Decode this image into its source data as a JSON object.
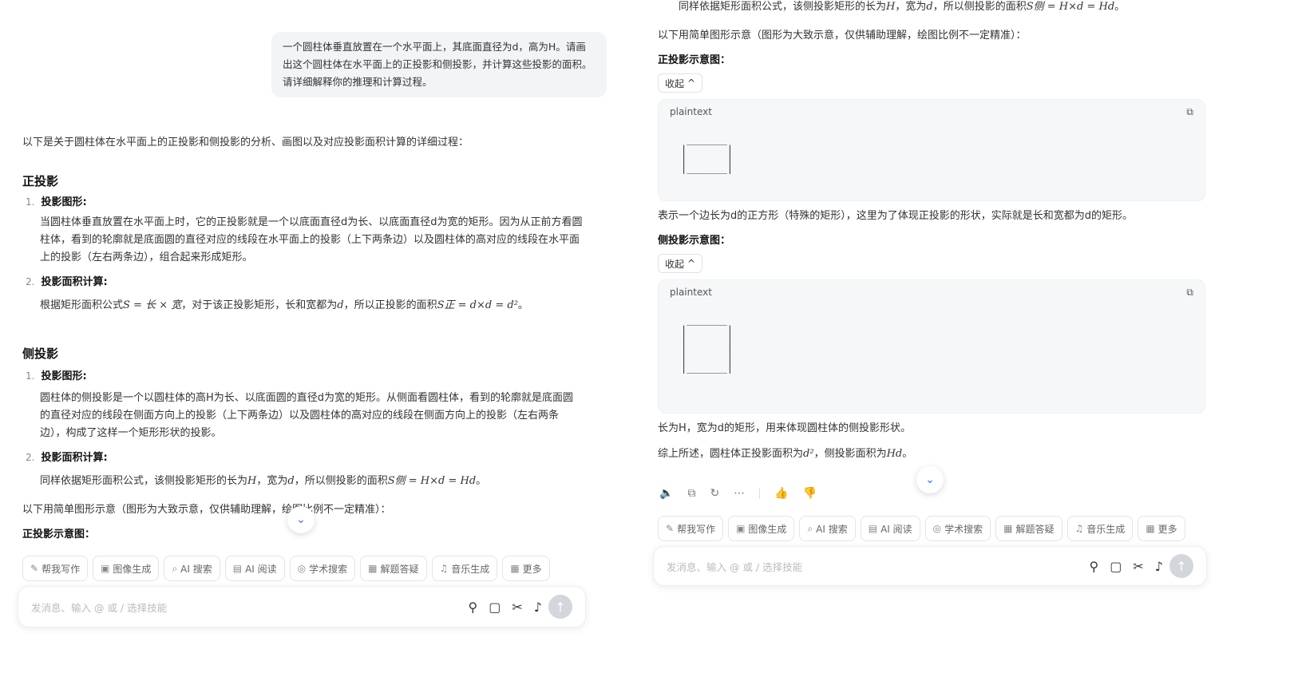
{
  "left": {
    "user_message": "一个圆柱体垂直放置在一个水平面上，其底面直径为d，高为H。请画出这个圆柱体在水平面上的正投影和侧投影，并计算这些投影的面积。请详细解释你的推理和计算过程。",
    "intro": "以下是关于圆柱体在水平面上的正投影和侧投影的分析、画图以及对应投影面积计算的详细过程：",
    "section1_title": "正投影",
    "s1_item1_num": "1.",
    "s1_item1_title": "投影图形",
    "s1_item1_body": "当圆柱体垂直放置在水平面上时，它的正投影就是一个以底面直径d为长、以底面直径d为宽的矩形。因为从正前方看圆柱体，看到的轮廓就是底面圆的直径对应的线段在水平面上的投影（上下两条边）以及圆柱体的高对应的线段在水平面上的投影（左右两条边），组合起来形成矩形。",
    "s1_item2_num": "2.",
    "s1_item2_title": "投影面积计算",
    "s1_item2_pre": "根据矩形面积公式",
    "s1_item2_formula1": "S = 长 × 宽",
    "s1_item2_mid": "，对于该正投影矩形，长和宽都为",
    "s1_item2_d": "d",
    "s1_item2_mid2": "，所以正投影的面积",
    "s1_item2_formula2": "S正 = d×d = d²",
    "s1_item2_end": "。",
    "section2_title": "侧投影",
    "s2_item1_num": "1.",
    "s2_item1_title": "投影图形",
    "s2_item1_body": "圆柱体的侧投影是一个以圆柱体的高H为长、以底面圆的直径d为宽的矩形。从侧面看圆柱体，看到的轮廓就是底面圆的直径对应的线段在侧面方向上的投影（上下两条边）以及圆柱体的高对应的线段在侧面方向上的投影（左右两条边），构成了这样一个矩形形状的投影。",
    "s2_item2_num": "2.",
    "s2_item2_title": "投影面积计算",
    "s2_item2_pre": "同样依据矩形面积公式，该侧投影矩形的长为",
    "s2_item2_H": "H",
    "s2_item2_mid": "，宽为",
    "s2_item2_d": "d",
    "s2_item2_mid2": "，所以侧投影的面积",
    "s2_item2_formula": "S侧 = H×d = Hd",
    "s2_item2_end": "。",
    "outro": "以下用简单图形示意（图形为大致示意，仅供辅助理解，绘图比例不一定精准）：",
    "outro_heading": "正投影示意图："
  },
  "right": {
    "top_pre": "同样依据矩形面积公式，该侧投影矩形的长为",
    "top_H": "H",
    "top_mid": "，宽为",
    "top_d": "d",
    "top_mid2": "，所以侧投影的面积",
    "top_formula": "S侧 = H×d = Hd",
    "top_end": "。",
    "diagram_intro": "以下用简单图形示意（图形为大致示意，仅供辅助理解，绘图比例不一定精准）：",
    "front_heading": "正投影示意图：",
    "collapse_label": "收起",
    "code_lang": "plaintext",
    "code_front": " _______\n|       |\n|       |\n|_______|",
    "front_caption": "表示一个边长为d的正方形（特殊的矩形），这里为了体现正投影的形状，实际就是长和宽都为d的矩形。",
    "side_heading": "侧投影示意图：",
    "code_side": " _______\n|       |\n|       |\n|       |\n|       |\n|_______|",
    "side_caption": "长为H，宽为d的矩形，用来体现圆柱体的侧投影形状。",
    "summary_pre": "综上所述，圆柱体正投影面积为",
    "summary_d2": "d²",
    "summary_mid": "，侧投影面积为",
    "summary_hd": "Hd",
    "summary_end": "。"
  },
  "toolbar": {
    "chips": [
      "帮我写作",
      "图像生成",
      "AI 搜索",
      "AI 阅读",
      "学术搜索",
      "解题答疑",
      "音乐生成",
      "更多"
    ],
    "input_placeholder": "发消息、输入 @ 或 / 选择技能"
  },
  "colors": {
    "accent": "#3a6df0",
    "bubble": "#f3f4f6",
    "code_bg": "#f6f7f9"
  }
}
